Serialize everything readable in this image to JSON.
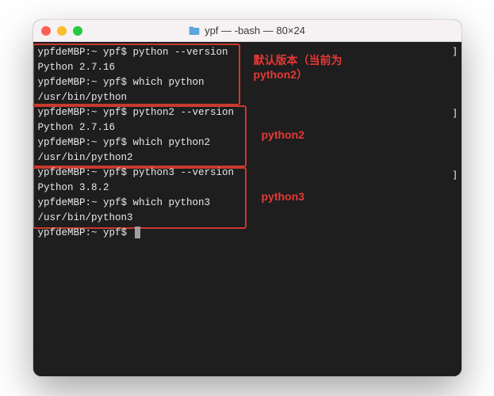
{
  "window": {
    "title": "ypf — -bash — 80×24"
  },
  "terminal": {
    "lines": [
      "ypfdeMBP:~ ypf$ python --version",
      "Python 2.7.16",
      "ypfdeMBP:~ ypf$ which python",
      "/usr/bin/python",
      "ypfdeMBP:~ ypf$ python2 --version",
      "Python 2.7.16",
      "ypfdeMBP:~ ypf$ which python2",
      "/usr/bin/python2",
      "ypfdeMBP:~ ypf$ python3 --version",
      "Python 3.8.2",
      "ypfdeMBP:~ ypf$ which python3",
      "/usr/bin/python3",
      "ypfdeMBP:~ ypf$ "
    ]
  },
  "annotations": [
    {
      "label": "默认版本（当前为python2）"
    },
    {
      "label": "python2"
    },
    {
      "label": "python3"
    }
  ]
}
